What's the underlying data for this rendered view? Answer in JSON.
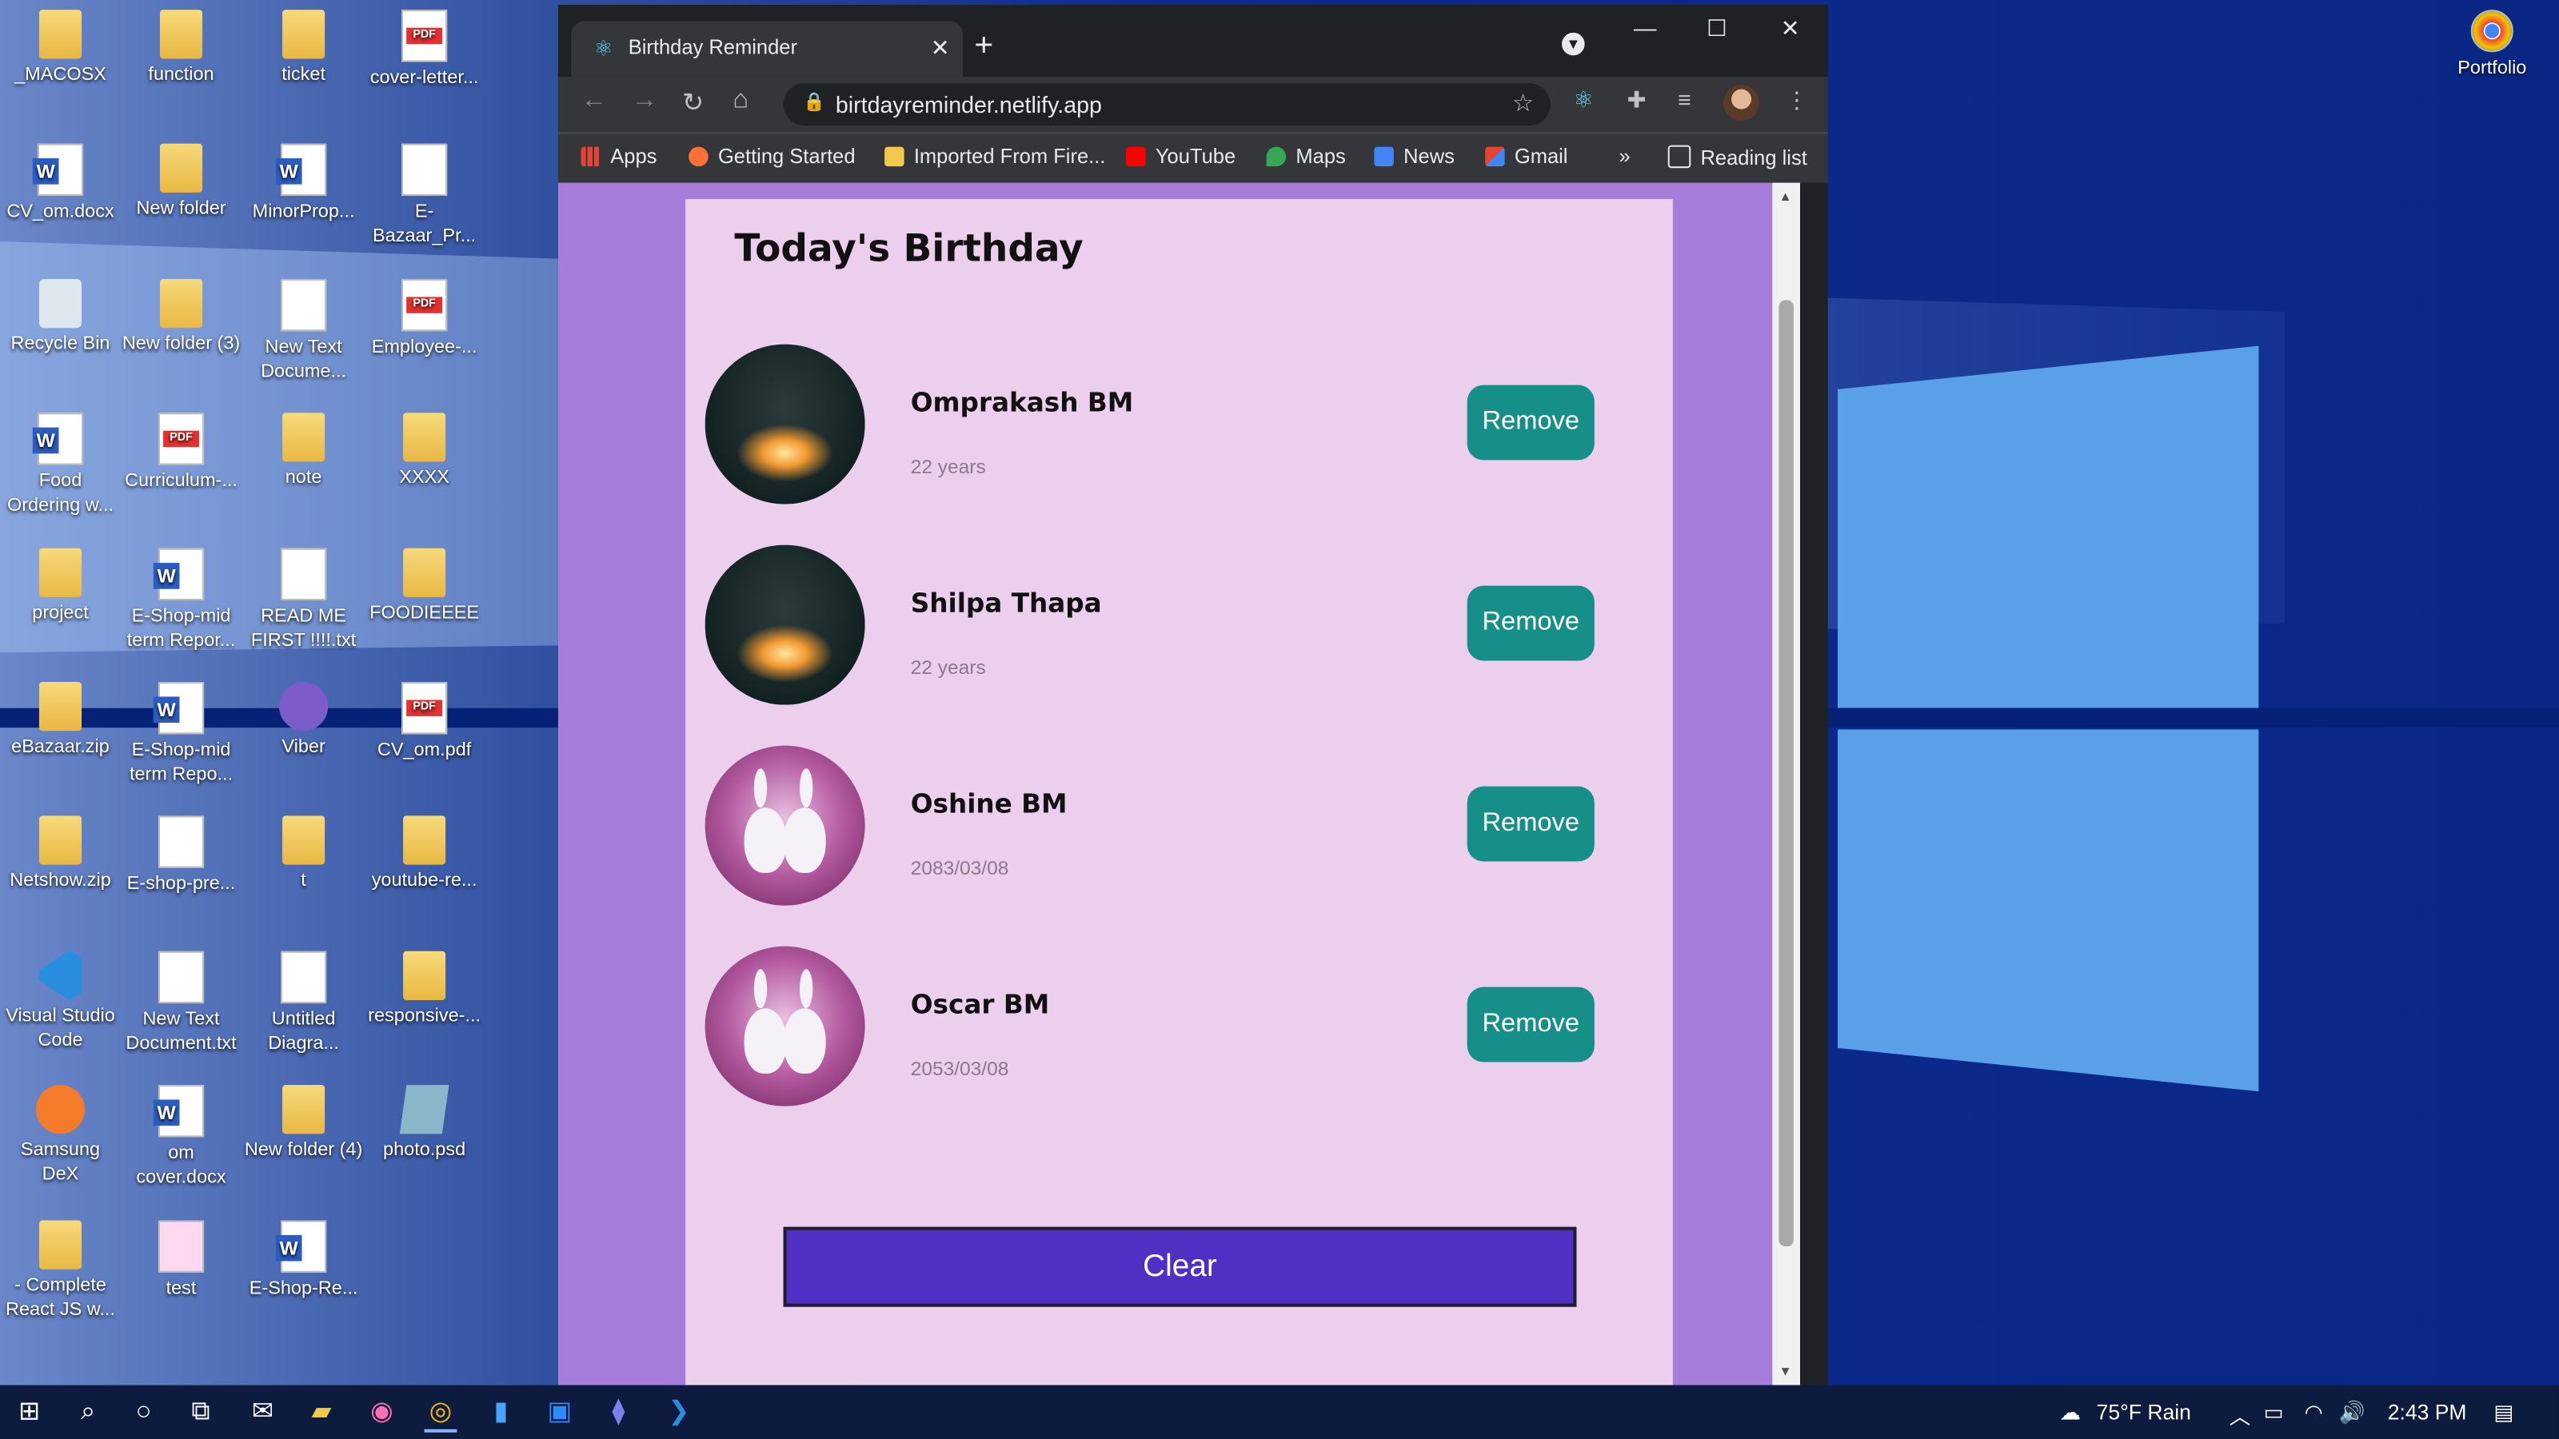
{
  "desktop": {
    "icons": [
      {
        "label": "_MACOSX"
      },
      {
        "label": "function"
      },
      {
        "label": "ticket"
      },
      {
        "label": "cover-letter..."
      },
      {
        "label": "CV_om.docx"
      },
      {
        "label": "New folder"
      },
      {
        "label": "MinorProp..."
      },
      {
        "label": "E-Bazaar_Pr..."
      },
      {
        "label": "Recycle Bin"
      },
      {
        "label": "New folder (3)"
      },
      {
        "label": "New Text Docume..."
      },
      {
        "label": "Employee-..."
      },
      {
        "label": "Food Ordering w..."
      },
      {
        "label": "Curriculum-..."
      },
      {
        "label": "note"
      },
      {
        "label": "XXXX"
      },
      {
        "label": "project"
      },
      {
        "label": "E-Shop-mid term Repor..."
      },
      {
        "label": "READ ME FIRST !!!!.txt"
      },
      {
        "label": "FOODIEEEE"
      },
      {
        "label": "eBazaar.zip"
      },
      {
        "label": "E-Shop-mid term Repo..."
      },
      {
        "label": "Viber"
      },
      {
        "label": "CV_om.pdf"
      },
      {
        "label": "Netshow.zip"
      },
      {
        "label": "E-shop-pre..."
      },
      {
        "label": "t"
      },
      {
        "label": "youtube-re..."
      },
      {
        "label": "Visual Studio Code"
      },
      {
        "label": "New Text Document.txt"
      },
      {
        "label": "Untitled Diagra..."
      },
      {
        "label": "responsive-..."
      },
      {
        "label": "Samsung DeX"
      },
      {
        "label": "om cover.docx"
      },
      {
        "label": "New folder (4)"
      },
      {
        "label": "photo.psd"
      },
      {
        "label": "- Complete React JS w..."
      },
      {
        "label": "test"
      },
      {
        "label": "E-Shop-Re..."
      }
    ],
    "right_icon": {
      "label": "Portfolio"
    }
  },
  "browser": {
    "tab_title": "Birthday Reminder",
    "url": "birtdayreminder.netlify.app",
    "bookmarks": [
      "Apps",
      "Getting Started",
      "Imported From Fire...",
      "YouTube",
      "Maps",
      "News",
      "Gmail"
    ],
    "overflow": "»",
    "reading_list": "Reading list"
  },
  "app": {
    "heading": "Today's Birthday",
    "people": [
      {
        "name": "Omprakash BM",
        "age": "22 years",
        "photo": "campfire"
      },
      {
        "name": "Shilpa Thapa",
        "age": "22 years",
        "photo": "campfire"
      },
      {
        "name": "Oshine BM",
        "age": "2083/03/08",
        "photo": "bunnies"
      },
      {
        "name": "Oscar BM",
        "age": "2053/03/08",
        "photo": "bunnies"
      }
    ],
    "remove_label": "Remove",
    "clear_label": "Clear"
  },
  "taskbar": {
    "weather": "75°F  Rain",
    "time": "2:43 PM"
  },
  "colors": {
    "page_bg": "#a67ddb",
    "card_bg": "#ebcfed",
    "remove_button": "#178f89",
    "clear_button": "#4f2fc4"
  }
}
